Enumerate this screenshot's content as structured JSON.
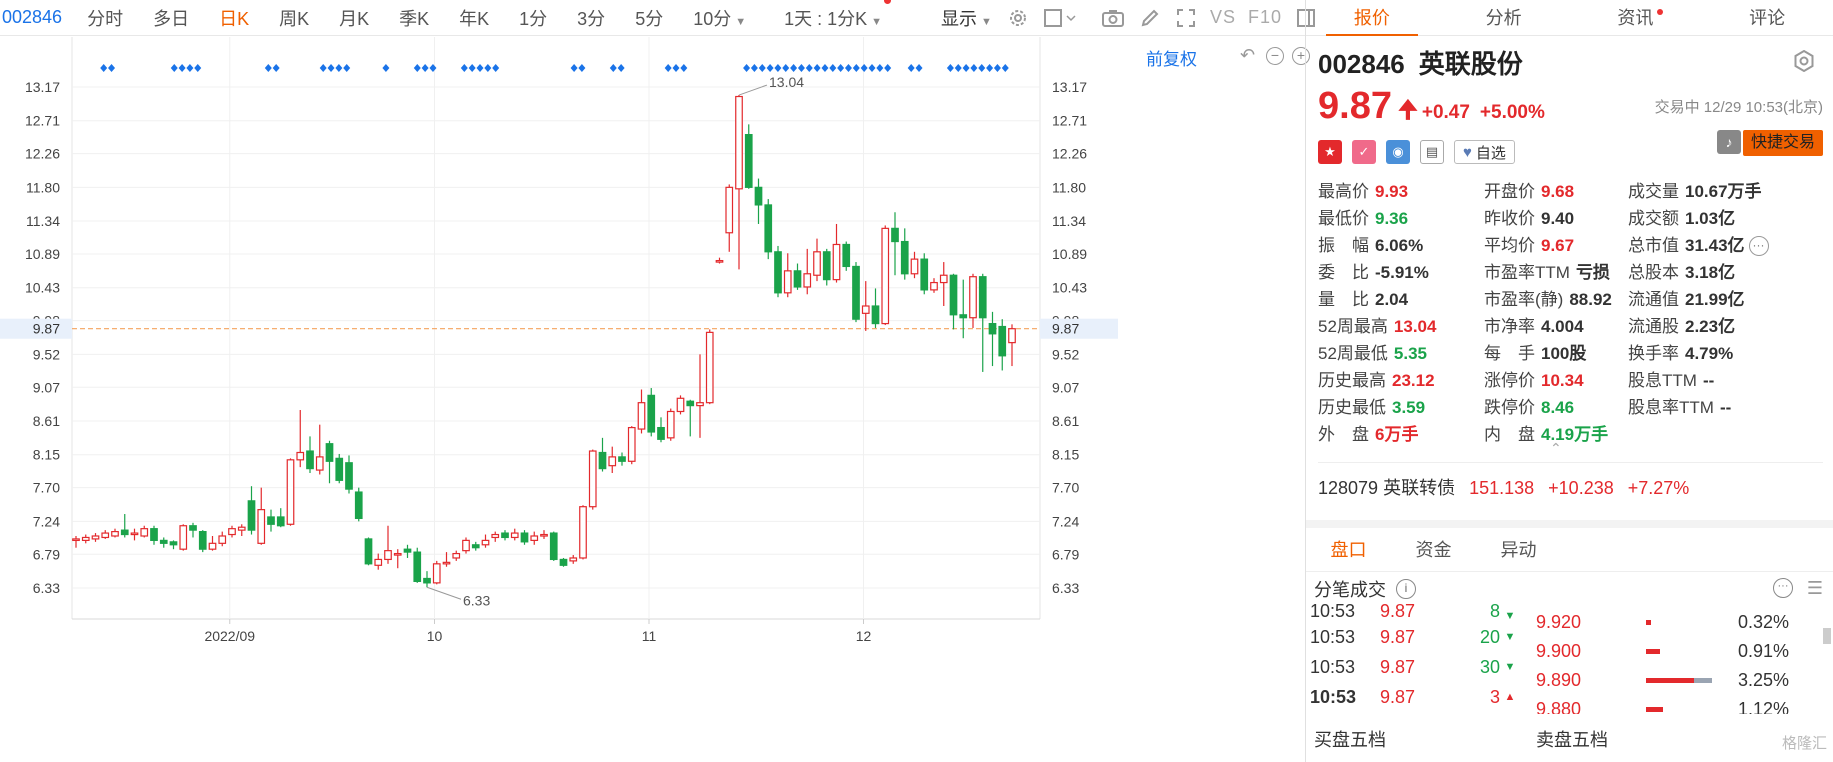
{
  "toolbar": {
    "code": "002846",
    "periods": [
      "分时",
      "多日",
      "日K",
      "周K",
      "月K",
      "季K",
      "年K",
      "1分",
      "3分",
      "5分",
      "10分"
    ],
    "active_period": "日K",
    "interval": "1天 : 1分K",
    "display": "显示",
    "vs": "VS",
    "f10": "F10"
  },
  "chart": {
    "restore_label": "前复权",
    "y_labels": [
      "13.17",
      "12.71",
      "12.26",
      "11.80",
      "11.34",
      "10.89",
      "10.43",
      "9.98",
      "9.52",
      "9.07",
      "8.61",
      "8.15",
      "7.70",
      "7.24",
      "6.79",
      "6.33"
    ],
    "x_labels": [
      "2022/09",
      "10",
      "11",
      "12"
    ],
    "current_price_label": "9.87",
    "high_annotation": "13.04",
    "low_annotation": "6.33"
  },
  "chart_data": {
    "type": "candlestick",
    "xlabel": "",
    "ylabel": "",
    "ylim": [
      6.1,
      13.3
    ],
    "current_price": 9.87,
    "colors": {
      "up": "#e3292c",
      "down": "#1aa34a",
      "current_line": "#f5a25d",
      "marker": "#1a73e8"
    },
    "month_labels": [
      {
        "label": "2022/09",
        "index": 17
      },
      {
        "label": "10",
        "index": 38
      },
      {
        "label": "11",
        "index": 60
      },
      {
        "label": "12",
        "index": 82
      }
    ],
    "candles": [
      [
        6.98,
        7.0,
        6.88,
        7.04
      ],
      [
        6.98,
        7.02,
        6.94,
        7.06
      ],
      [
        7.0,
        7.04,
        6.96,
        7.08
      ],
      [
        7.02,
        7.08,
        7.0,
        7.12
      ],
      [
        7.04,
        7.1,
        7.02,
        7.14
      ],
      [
        7.12,
        7.06,
        7.02,
        7.34
      ],
      [
        7.06,
        7.08,
        6.98,
        7.14
      ],
      [
        7.04,
        7.14,
        7.02,
        7.18
      ],
      [
        7.14,
        6.98,
        6.92,
        7.18
      ],
      [
        6.98,
        6.94,
        6.88,
        7.02
      ],
      [
        6.96,
        6.92,
        6.86,
        6.98
      ],
      [
        6.86,
        7.18,
        6.84,
        7.2
      ],
      [
        7.18,
        7.12,
        7.02,
        7.22
      ],
      [
        7.1,
        6.86,
        6.82,
        7.12
      ],
      [
        6.86,
        6.94,
        6.84,
        7.04
      ],
      [
        6.94,
        7.04,
        6.9,
        7.1
      ],
      [
        7.06,
        7.14,
        7.02,
        7.18
      ],
      [
        7.12,
        7.16,
        7.04,
        7.2
      ],
      [
        7.52,
        7.12,
        7.06,
        7.72
      ],
      [
        6.94,
        7.4,
        6.92,
        7.7
      ],
      [
        7.3,
        7.2,
        7.1,
        7.4
      ],
      [
        7.3,
        7.18,
        7.16,
        7.42
      ],
      [
        7.2,
        8.08,
        7.18,
        8.1
      ],
      [
        8.08,
        8.18,
        7.98,
        8.76
      ],
      [
        8.2,
        7.96,
        7.9,
        8.4
      ],
      [
        7.94,
        8.12,
        7.88,
        8.56
      ],
      [
        8.3,
        8.06,
        7.76,
        8.34
      ],
      [
        8.1,
        7.8,
        7.76,
        8.16
      ],
      [
        8.04,
        7.68,
        7.62,
        8.14
      ],
      [
        7.64,
        7.28,
        7.24,
        7.7
      ],
      [
        7.0,
        6.66,
        6.64,
        7.02
      ],
      [
        6.64,
        6.72,
        6.58,
        6.8
      ],
      [
        6.72,
        6.84,
        6.66,
        7.18
      ],
      [
        6.78,
        6.8,
        6.6,
        6.86
      ],
      [
        6.86,
        6.82,
        6.74,
        6.92
      ],
      [
        6.82,
        6.42,
        6.4,
        6.88
      ],
      [
        6.46,
        6.4,
        6.34,
        6.56
      ],
      [
        6.4,
        6.66,
        6.38,
        6.7
      ],
      [
        6.66,
        6.68,
        6.62,
        6.82
      ],
      [
        6.74,
        6.8,
        6.7,
        6.84
      ],
      [
        6.84,
        6.98,
        6.8,
        7.02
      ],
      [
        6.92,
        6.88,
        6.84,
        6.96
      ],
      [
        6.92,
        6.98,
        6.88,
        7.06
      ],
      [
        7.02,
        7.06,
        6.96,
        7.1
      ],
      [
        7.08,
        7.02,
        6.98,
        7.12
      ],
      [
        7.02,
        7.08,
        6.98,
        7.14
      ],
      [
        7.08,
        6.96,
        6.92,
        7.12
      ],
      [
        6.98,
        7.04,
        6.92,
        7.1
      ],
      [
        7.04,
        7.06,
        7.0,
        7.12
      ],
      [
        7.08,
        6.72,
        6.7,
        7.1
      ],
      [
        6.72,
        6.64,
        6.62,
        6.74
      ],
      [
        6.7,
        6.74,
        6.66,
        6.78
      ],
      [
        6.74,
        7.44,
        6.72,
        7.46
      ],
      [
        7.44,
        8.2,
        7.4,
        8.22
      ],
      [
        8.18,
        7.96,
        7.92,
        8.38
      ],
      [
        8.0,
        8.12,
        7.9,
        8.26
      ],
      [
        8.12,
        8.06,
        8.0,
        8.18
      ],
      [
        8.06,
        8.52,
        8.02,
        8.54
      ],
      [
        8.5,
        8.86,
        8.44,
        9.04
      ],
      [
        8.96,
        8.46,
        8.4,
        9.06
      ],
      [
        8.52,
        8.36,
        8.32,
        8.66
      ],
      [
        8.38,
        8.74,
        8.34,
        8.78
      ],
      [
        8.74,
        8.92,
        8.7,
        8.96
      ],
      [
        8.88,
        8.82,
        8.4,
        8.9
      ],
      [
        8.82,
        8.86,
        8.38,
        9.52
      ],
      [
        8.86,
        9.82,
        8.84,
        9.86
      ],
      [
        10.78,
        10.8,
        10.76,
        10.84
      ],
      [
        11.18,
        11.8,
        10.92,
        11.84
      ],
      [
        11.78,
        13.04,
        10.68,
        13.06
      ],
      [
        12.52,
        11.8,
        11.78,
        12.66
      ],
      [
        11.8,
        11.56,
        11.3,
        11.92
      ],
      [
        11.56,
        10.92,
        10.82,
        11.64
      ],
      [
        10.92,
        10.36,
        10.3,
        11.0
      ],
      [
        10.36,
        10.66,
        10.3,
        10.9
      ],
      [
        10.66,
        10.44,
        10.4,
        10.76
      ],
      [
        10.44,
        10.62,
        10.34,
        10.96
      ],
      [
        10.6,
        10.92,
        10.52,
        11.1
      ],
      [
        10.92,
        10.54,
        10.46,
        10.96
      ],
      [
        10.54,
        11.02,
        10.5,
        11.3
      ],
      [
        11.02,
        10.72,
        10.66,
        11.06
      ],
      [
        10.72,
        10.0,
        9.96,
        10.78
      ],
      [
        10.08,
        10.18,
        9.84,
        10.52
      ],
      [
        10.18,
        9.94,
        9.88,
        10.42
      ],
      [
        9.94,
        11.24,
        9.92,
        11.28
      ],
      [
        11.24,
        11.06,
        10.6,
        11.46
      ],
      [
        11.06,
        10.62,
        10.54,
        11.24
      ],
      [
        10.62,
        10.82,
        10.56,
        10.92
      ],
      [
        10.82,
        10.4,
        10.34,
        10.9
      ],
      [
        10.4,
        10.5,
        10.36,
        10.56
      ],
      [
        10.5,
        10.6,
        10.18,
        10.78
      ],
      [
        10.6,
        10.06,
        9.86,
        10.62
      ],
      [
        10.06,
        10.02,
        9.74,
        10.54
      ],
      [
        10.02,
        10.58,
        9.88,
        10.62
      ],
      [
        10.58,
        10.02,
        9.28,
        10.62
      ],
      [
        9.94,
        9.8,
        9.36,
        10.1
      ],
      [
        9.9,
        9.5,
        9.3,
        10.0
      ],
      [
        9.68,
        9.87,
        9.36,
        9.93
      ]
    ],
    "marker_groups": [
      [
        2,
        2
      ],
      [
        11,
        4
      ],
      [
        23,
        2
      ],
      [
        30,
        4
      ],
      [
        38,
        1
      ],
      [
        42,
        3
      ],
      [
        48,
        5
      ],
      [
        62,
        2
      ],
      [
        67,
        2
      ],
      [
        74,
        3
      ],
      [
        84,
        19
      ],
      [
        105,
        2
      ],
      [
        110,
        8
      ]
    ]
  },
  "panel": {
    "tabs": [
      "报价",
      "分析",
      "资讯",
      "评论"
    ],
    "stock_code": "002846",
    "stock_name": "英联股份",
    "price": "9.87",
    "change": "+0.47",
    "change_pct": "+5.00%",
    "status": "交易中 12/29 10:53(北京)",
    "favorite": "自选",
    "quick_trade": "快捷交易",
    "stats": [
      [
        {
          "label": "最高价",
          "value": "9.93",
          "dir": "up"
        },
        {
          "label": "开盘价",
          "value": "9.68",
          "dir": "up"
        },
        {
          "label": "成交量",
          "value": "10.67万手",
          "dir": "neutral"
        }
      ],
      [
        {
          "label": "最低价",
          "value": "9.36",
          "dir": "down"
        },
        {
          "label": "昨收价",
          "value": "9.40",
          "dir": "neutral"
        },
        {
          "label": "成交额",
          "value": "1.03亿",
          "dir": "neutral"
        }
      ],
      [
        {
          "label": "振　幅",
          "value": "6.06%",
          "dir": "neutral"
        },
        {
          "label": "平均价",
          "value": "9.67",
          "dir": "up"
        },
        {
          "label": "总市值",
          "value": "31.43亿",
          "dir": "neutral"
        }
      ],
      [
        {
          "label": "委　比",
          "value": "-5.91%",
          "dir": "neutral"
        },
        {
          "label": "市盈率TTM",
          "value": "亏损",
          "dir": "neutral"
        },
        {
          "label": "总股本",
          "value": "3.18亿",
          "dir": "neutral"
        }
      ],
      [
        {
          "label": "量　比",
          "value": "2.04",
          "dir": "neutral"
        },
        {
          "label": "市盈率(静)",
          "value": "88.92",
          "dir": "neutral"
        },
        {
          "label": "流通值",
          "value": "21.99亿",
          "dir": "neutral"
        }
      ],
      [
        {
          "label": "52周最高",
          "value": "13.04",
          "dir": "up"
        },
        {
          "label": "市净率",
          "value": "4.004",
          "dir": "neutral"
        },
        {
          "label": "流通股",
          "value": "2.23亿",
          "dir": "neutral"
        }
      ],
      [
        {
          "label": "52周最低",
          "value": "5.35",
          "dir": "down"
        },
        {
          "label": "每　手",
          "value": "100股",
          "dir": "neutral"
        },
        {
          "label": "换手率",
          "value": "4.79%",
          "dir": "neutral"
        }
      ],
      [
        {
          "label": "历史最高",
          "value": "23.12",
          "dir": "up"
        },
        {
          "label": "涨停价",
          "value": "10.34",
          "dir": "up"
        },
        {
          "label": "股息TTM",
          "value": "--",
          "dir": "neutral"
        }
      ],
      [
        {
          "label": "历史最低",
          "value": "3.59",
          "dir": "down"
        },
        {
          "label": "跌停价",
          "value": "8.46",
          "dir": "down"
        },
        {
          "label": "股息率TTM",
          "value": "--",
          "dir": "neutral"
        }
      ],
      [
        {
          "label": "外　盘",
          "value": "6万手",
          "dir": "up"
        },
        {
          "label": "内　盘",
          "value": "4.19万手",
          "dir": "down"
        }
      ]
    ],
    "bond": {
      "code_name": "128079 英联转债",
      "price": "151.138",
      "change": "+10.238",
      "change_pct": "+7.27%"
    },
    "tabs2": [
      "盘口",
      "资金",
      "异动"
    ],
    "ticks_title": "分笔成交",
    "trades": [
      {
        "time": "10:53",
        "price": "9.87",
        "vol": "8",
        "dir": "down"
      },
      {
        "time": "10:53",
        "price": "9.87",
        "vol": "20",
        "dir": "down"
      },
      {
        "time": "10:53",
        "price": "9.87",
        "vol": "30",
        "dir": "down"
      },
      {
        "time": "10:53",
        "price": "9.87",
        "vol": "3",
        "dir": "up"
      }
    ],
    "levels": [
      {
        "price": "9.920",
        "pct": "0.32%",
        "share": 0.032
      },
      {
        "price": "9.900",
        "pct": "0.91%",
        "share": 0.091
      },
      {
        "price": "9.890",
        "pct": "3.25%",
        "share": 0.325
      },
      {
        "price": "9.880",
        "pct": "1.12%",
        "share": 0.112
      }
    ],
    "buy_book": "买盘五档",
    "sell_book": "卖盘五档",
    "watermark": "格隆汇"
  }
}
